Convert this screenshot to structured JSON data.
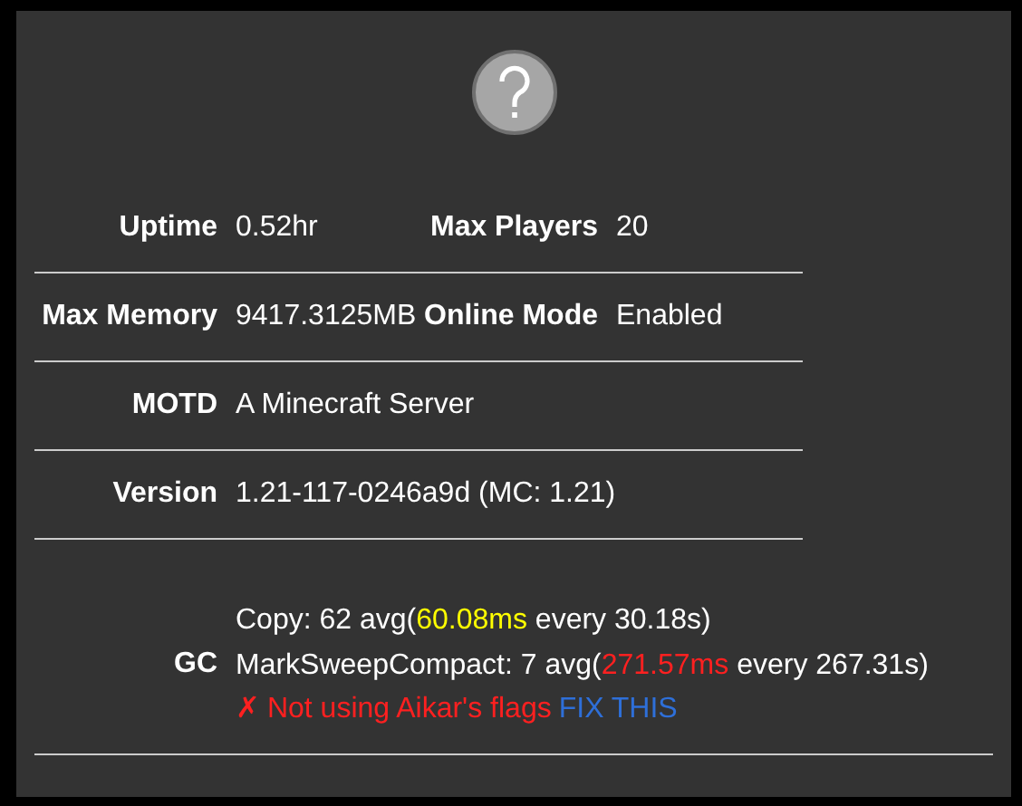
{
  "icon": {
    "kind": "question"
  },
  "rows": [
    {
      "pairs": [
        {
          "label": "Uptime",
          "value": "0.52hr"
        },
        {
          "label": "Max Players",
          "value": "20"
        }
      ]
    },
    {
      "pairs": [
        {
          "label": "Max Memory",
          "value": "9417.3125MB"
        },
        {
          "label": "Online Mode",
          "value": "Enabled"
        }
      ]
    },
    {
      "pairs": [
        {
          "label": "MOTD",
          "value": "A Minecraft Server"
        }
      ]
    },
    {
      "pairs": [
        {
          "label": "Version",
          "value": "1.21-117-0246a9d (MC: 1.21)"
        }
      ]
    }
  ],
  "gc": {
    "label": "GC",
    "lines": [
      {
        "parts": [
          {
            "kind": "normal",
            "text": "Copy: 62 avg("
          },
          {
            "kind": "warn",
            "text": "60.08ms"
          },
          {
            "kind": "normal",
            "text": " every 30.18s)"
          }
        ]
      },
      {
        "parts": [
          {
            "kind": "normal",
            "text": "MarkSweepCompact: 7 avg("
          },
          {
            "kind": "bad",
            "text": "271.57ms"
          },
          {
            "kind": "normal",
            "text": " every 267.31s)"
          }
        ]
      },
      {
        "parts": [
          {
            "kind": "bad",
            "text": "✗ Not using Aikar's flags"
          },
          {
            "kind": "link",
            "text": "FIX THIS"
          }
        ]
      }
    ]
  }
}
